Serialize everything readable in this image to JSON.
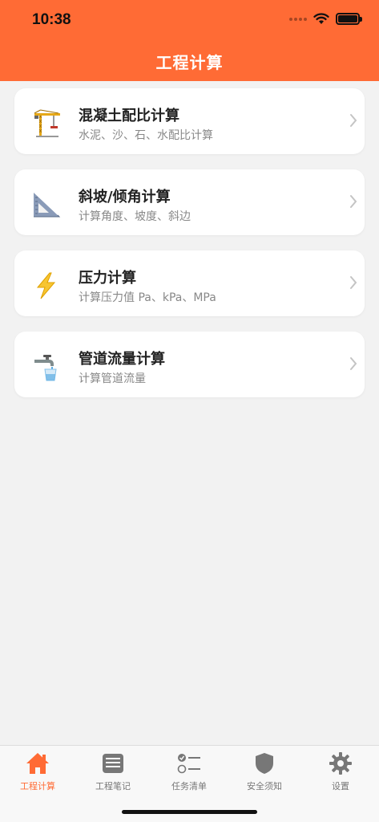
{
  "status_bar": {
    "time": "10:38"
  },
  "header": {
    "title": "工程计算"
  },
  "colors": {
    "accent": "#ff6b35",
    "inactive": "#777777"
  },
  "calculators": [
    {
      "icon": "crane-icon",
      "title": "混凝土配比计算",
      "subtitle": "水泥、沙、石、水配比计算"
    },
    {
      "icon": "triangle-ruler-icon",
      "title": "斜坡/倾角计算",
      "subtitle": "计算角度、坡度、斜边"
    },
    {
      "icon": "lightning-icon",
      "title": "压力计算",
      "subtitle": "计算压力值 Pa、kPa、MPa"
    },
    {
      "icon": "faucet-icon",
      "title": "管道流量计算",
      "subtitle": "计算管道流量"
    }
  ],
  "tabbar": {
    "items": [
      {
        "icon": "home-icon",
        "label": "工程计算",
        "active": true
      },
      {
        "icon": "note-icon",
        "label": "工程笔记",
        "active": false
      },
      {
        "icon": "checklist-icon",
        "label": "任务清单",
        "active": false
      },
      {
        "icon": "shield-icon",
        "label": "安全须知",
        "active": false
      },
      {
        "icon": "gear-icon",
        "label": "设置",
        "active": false
      }
    ]
  }
}
